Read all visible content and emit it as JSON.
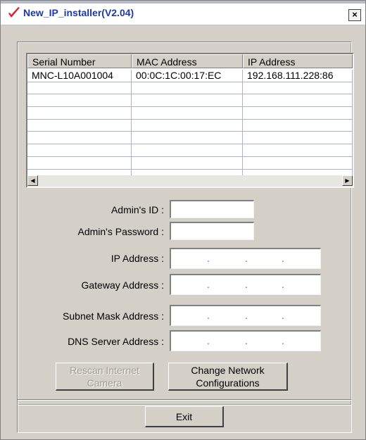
{
  "window": {
    "title": "New_IP_installer(V2.04)",
    "close_glyph": "×"
  },
  "device_list": {
    "columns": [
      "Serial Number",
      "MAC Address",
      "IP Address"
    ],
    "rows": [
      [
        "MNC-L10A001004",
        "00:0C:1C:00:17:EC",
        "192.168.111.228:86"
      ]
    ],
    "scroll_left_glyph": "◀",
    "scroll_right_glyph": "▶"
  },
  "form": {
    "admin_id_label": "Admin's ID :",
    "admin_id_value": "",
    "admin_password_label": "Admin's Password :",
    "admin_password_value": "",
    "ip_address_label": "IP Address :",
    "gateway_label": "Gateway Address :",
    "subnet_label": "Subnet Mask Address :",
    "dns_label": "DNS Server Address :",
    "ip_dot": "."
  },
  "buttons": {
    "rescan_label": "Rescan Internet Camera",
    "change_label": "Change Network Configurations",
    "exit_label": "Exit"
  },
  "colors": {
    "title_text": "#1a3aa8",
    "window_bg": "#d4d0c8",
    "app_icon_red": "#d81f26"
  }
}
